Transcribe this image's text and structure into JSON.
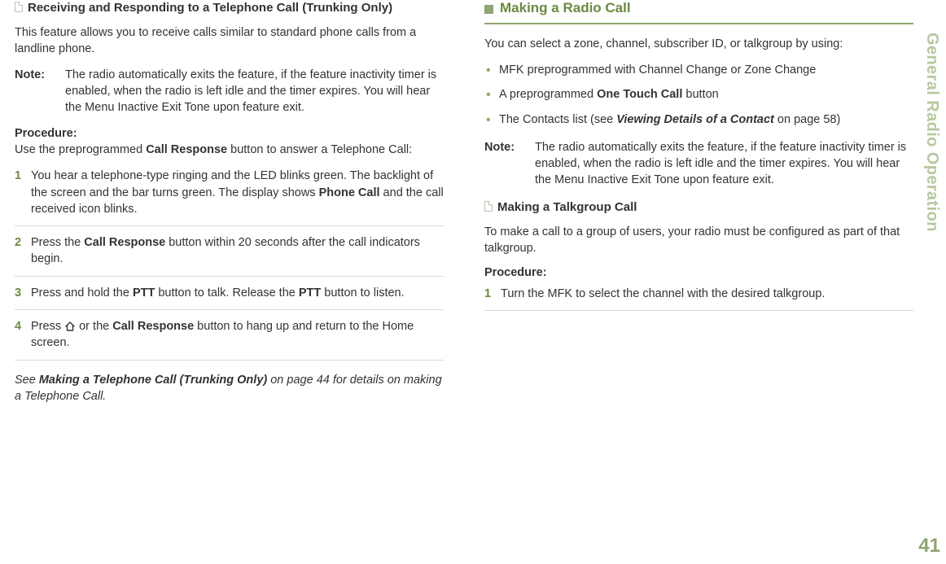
{
  "sideLabel": "General Radio Operation",
  "pageNumber": "41",
  "left": {
    "heading": "Receiving and Responding to a Telephone Call (Trunking Only)",
    "intro": "This feature allows you to receive calls similar to standard phone calls from a landline phone.",
    "noteLabel": "Note:",
    "noteBody": "The radio automatically exits the feature, if the feature inactivity timer is enabled, when the radio is left idle and the timer expires. You will hear the Menu Inactive Exit Tone upon feature exit.",
    "procLabel": "Procedure:",
    "procIntroA": "Use the preprogrammed ",
    "procIntroB": "Call Response",
    "procIntroC": " button to answer a Telephone Call:",
    "step1a": "You hear a telephone-type ringing and the LED blinks green. The backlight of the screen and the bar turns green. The display shows ",
    "step1b": "Phone Call",
    "step1c": " and the call received icon blinks.",
    "step2a": "Press the ",
    "step2b": "Call Response",
    "step2c": " button within 20 seconds after the call indicators begin.",
    "step3a": "Press and hold the ",
    "step3b": "PTT",
    "step3c": " button to talk. Release the ",
    "step3d": "PTT",
    "step3e": " button to listen.",
    "step4a": "Press ",
    "step4b": " or the ",
    "step4c": "Call Response",
    "step4d": " button to hang up and return to the Home screen.",
    "seeA": "See ",
    "seeB": "Making a Telephone Call (Trunking Only)",
    "seeC": " on page 44 for details on making a Telephone Call."
  },
  "right": {
    "sectionTitle": "Making a Radio Call",
    "intro": "You can select a zone, channel, subscriber ID, or talkgroup by using:",
    "bullet1": "MFK preprogrammed with Channel Change or Zone Change",
    "bullet2a": "A preprogrammed ",
    "bullet2b": "One Touch Call",
    "bullet2c": " button",
    "bullet3a": "The Contacts list (see ",
    "bullet3b": "Viewing Details of a Contact",
    "bullet3c": " on page 58)",
    "noteLabel": "Note:",
    "noteBody": "The radio automatically exits the feature, if the feature inactivity timer is enabled, when the radio is left idle and the timer expires. You will hear the Menu Inactive Exit Tone upon feature exit.",
    "subHeading": "Making a Talkgroup Call",
    "subIntro": "To make a call to a group of users, your radio must be configured as part of that talkgroup.",
    "procLabel": "Procedure:",
    "step1": "Turn the MFK to select the channel with the desired talkgroup."
  }
}
